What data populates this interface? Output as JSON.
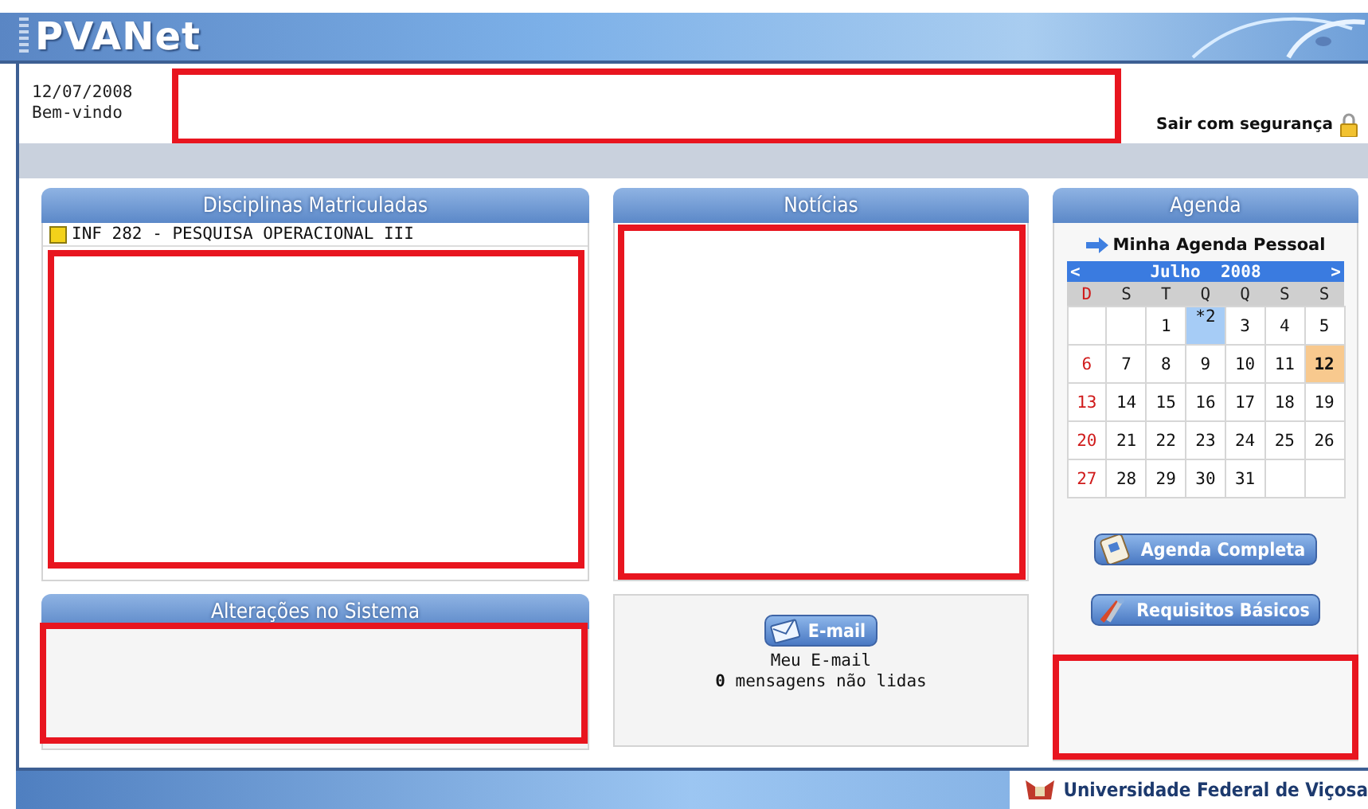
{
  "banner": {
    "title": "PVANet"
  },
  "header": {
    "date": "12/07/2008",
    "greeting": "Bem-vindo",
    "user_redacted": true,
    "logout": "Sair com segurança"
  },
  "disciplinas": {
    "title": "Disciplinas Matriculadas",
    "items": [
      {
        "label": "INF 282 - PESQUISA OPERACIONAL III"
      }
    ],
    "redacted": true
  },
  "alteracoes": {
    "title": "Alterações no Sistema",
    "redacted": true
  },
  "noticias": {
    "title": "Notícias",
    "redacted": true
  },
  "email": {
    "button": "E-mail",
    "label": "Meu E-mail",
    "count": "0",
    "unread_text": "mensagens não lidas"
  },
  "agenda": {
    "title": "Agenda",
    "link": "Minha Agenda Pessoal",
    "calendar": {
      "prev": "<",
      "month": "Julho",
      "year": "2008",
      "next": ">",
      "weekdays": [
        "D",
        "S",
        "T",
        "Q",
        "Q",
        "S",
        "S"
      ],
      "weeks": [
        [
          {
            "kind": "empty"
          },
          {
            "kind": "empty"
          },
          {
            "kind": "day",
            "day": "1",
            "event": false,
            "today": false
          },
          {
            "kind": "day",
            "day": "*2",
            "event": true,
            "today": false
          },
          {
            "kind": "day",
            "day": "3",
            "event": false,
            "today": false
          },
          {
            "kind": "day",
            "day": "4",
            "event": false,
            "today": false
          },
          {
            "kind": "day",
            "day": "5",
            "event": false,
            "today": false
          }
        ],
        [
          {
            "kind": "day",
            "day": "6",
            "event": false,
            "today": false
          },
          {
            "kind": "day",
            "day": "7",
            "event": false,
            "today": false
          },
          {
            "kind": "day",
            "day": "8",
            "event": false,
            "today": false
          },
          {
            "kind": "day",
            "day": "9",
            "event": false,
            "today": false
          },
          {
            "kind": "day",
            "day": "10",
            "event": false,
            "today": false
          },
          {
            "kind": "day",
            "day": "11",
            "event": false,
            "today": false
          },
          {
            "kind": "day",
            "day": "12",
            "event": false,
            "today": true
          }
        ],
        [
          {
            "kind": "day",
            "day": "13",
            "event": false,
            "today": false
          },
          {
            "kind": "day",
            "day": "14",
            "event": false,
            "today": false
          },
          {
            "kind": "day",
            "day": "15",
            "event": false,
            "today": false
          },
          {
            "kind": "day",
            "day": "16",
            "event": false,
            "today": false
          },
          {
            "kind": "day",
            "day": "17",
            "event": false,
            "today": false
          },
          {
            "kind": "day",
            "day": "18",
            "event": false,
            "today": false
          },
          {
            "kind": "day",
            "day": "19",
            "event": false,
            "today": false
          }
        ],
        [
          {
            "kind": "day",
            "day": "20",
            "event": false,
            "today": false
          },
          {
            "kind": "day",
            "day": "21",
            "event": false,
            "today": false
          },
          {
            "kind": "day",
            "day": "22",
            "event": false,
            "today": false
          },
          {
            "kind": "day",
            "day": "23",
            "event": false,
            "today": false
          },
          {
            "kind": "day",
            "day": "24",
            "event": false,
            "today": false
          },
          {
            "kind": "day",
            "day": "25",
            "event": false,
            "today": false
          },
          {
            "kind": "day",
            "day": "26",
            "event": false,
            "today": false
          }
        ],
        [
          {
            "kind": "day",
            "day": "27",
            "event": false,
            "today": false
          },
          {
            "kind": "day",
            "day": "28",
            "event": false,
            "today": false
          },
          {
            "kind": "day",
            "day": "29",
            "event": false,
            "today": false
          },
          {
            "kind": "day",
            "day": "30",
            "event": false,
            "today": false
          },
          {
            "kind": "day",
            "day": "31",
            "event": false,
            "today": false
          },
          {
            "kind": "empty"
          },
          {
            "kind": "empty"
          }
        ]
      ]
    },
    "buttons": [
      "Agenda Completa",
      "Requisitos Básicos"
    ],
    "redacted": true
  },
  "footer": {
    "institution": "Universidade Federal de Viçosa"
  }
}
